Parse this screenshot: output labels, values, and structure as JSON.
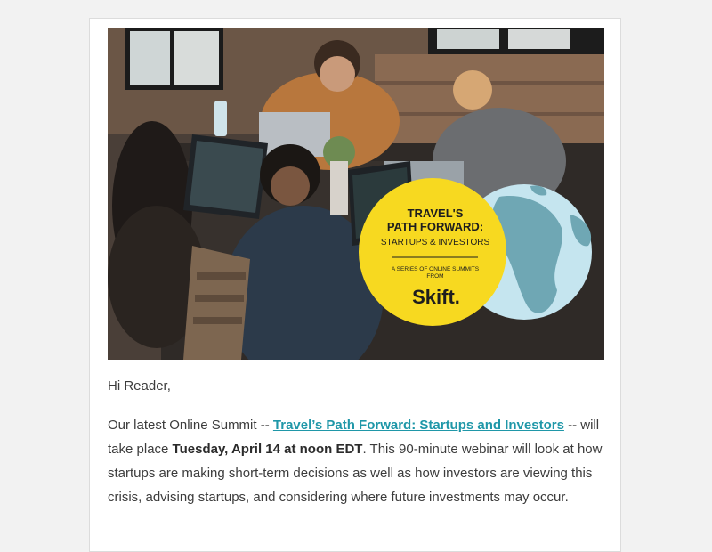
{
  "hero": {
    "image": "people-working-on-laptops-around-table-photo",
    "badge": {
      "title_line1": "TRAVEL'S",
      "title_line2": "PATH FORWARD:",
      "subtitle": "STARTUPS & INVESTORS",
      "series_line1": "A SERIES OF ONLINE SUMMITS",
      "series_line2": "FROM",
      "brand": "Skift."
    },
    "colors": {
      "badge_yellow": "#f7d920",
      "globe_blue": "#c5e5ef",
      "land": "#6fa7b4"
    }
  },
  "body": {
    "greeting": "Hi Reader,",
    "intro_prefix": "Our latest Online Summit -- ",
    "event_link": "Travel’s Path Forward: Startups and Investors",
    "intro_mid": " -- will take place ",
    "event_time": "Tuesday, April 14 at noon EDT",
    "intro_suffix": ". This 90-minute webinar will look at how startups are making short-term decisions as well as how investors are viewing this crisis, advising startups, and considering where future investments may occur."
  },
  "colors": {
    "link": "#1f97a8",
    "text": "#3c3c3c",
    "page_bg": "#f2f2f2"
  }
}
